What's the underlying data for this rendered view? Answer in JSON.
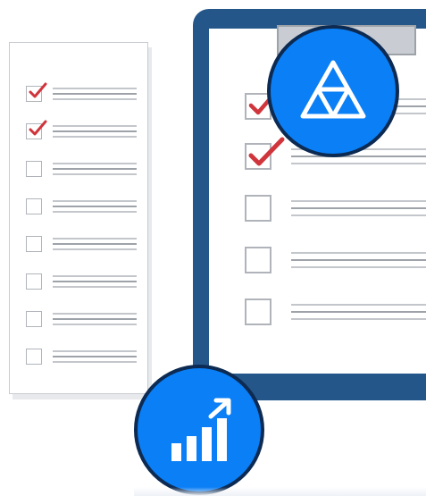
{
  "colors": {
    "board_frame": "#24568a",
    "badge_fill": "#0b7ff5",
    "badge_ring": "#0c2a52",
    "check_mark": "#d0353c",
    "checkbox_border": "#b0b4ba",
    "line_placeholder": "#c3c6cb"
  },
  "icons": {
    "top_badge": "triforce-triangle-icon",
    "bottom_badge": "growth-bar-chart-arrow-icon"
  },
  "paper_checklist": {
    "rows": [
      {
        "checked": true
      },
      {
        "checked": true
      },
      {
        "checked": false
      },
      {
        "checked": false
      },
      {
        "checked": false
      },
      {
        "checked": false
      },
      {
        "checked": false
      },
      {
        "checked": false
      }
    ]
  },
  "board_checklist": {
    "rows": [
      {
        "checked": true
      },
      {
        "checked": true
      },
      {
        "checked": false
      },
      {
        "checked": false
      },
      {
        "checked": false
      }
    ]
  }
}
